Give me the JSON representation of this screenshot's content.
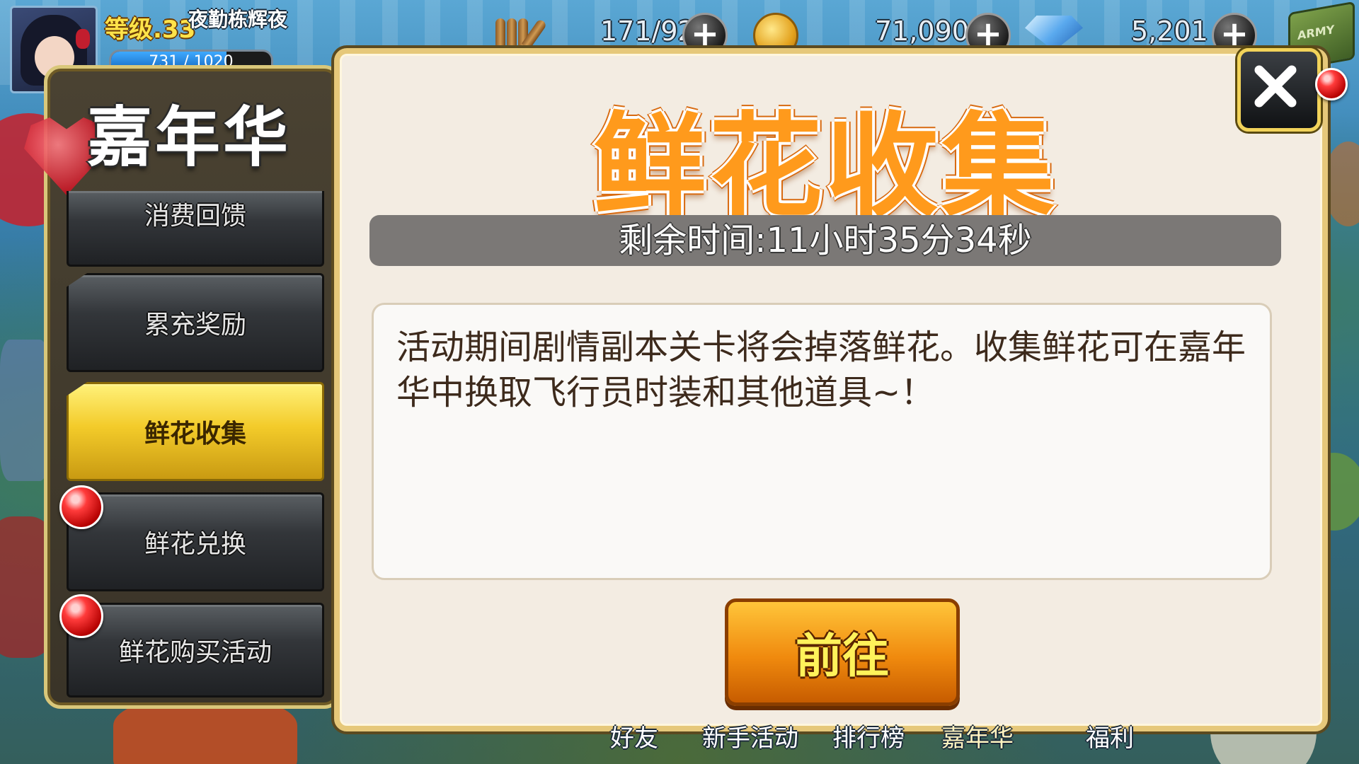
{
  "player": {
    "level_label": "等级.33",
    "name": "夜勤栋辉夜",
    "exp_text": "731 / 1020",
    "exp_progress": 0.72
  },
  "resources": {
    "stamina": "171/92",
    "gold": "71,090",
    "diamond": "5,201"
  },
  "army_box_label": "ARMY",
  "sidebar": {
    "title": "嘉年华",
    "items": [
      {
        "label": "消费回馈",
        "active": false,
        "badge": false
      },
      {
        "label": "累充奖励",
        "active": false,
        "badge": false
      },
      {
        "label": "鲜花收集",
        "active": true,
        "badge": false
      },
      {
        "label": "鲜花兑换",
        "active": false,
        "badge": true
      },
      {
        "label": "鲜花购买活动",
        "active": false,
        "badge": true
      }
    ]
  },
  "popup": {
    "title": "鲜花收集",
    "timer_text": "剩余时间:11小时35分34秒",
    "description": "活动期间剧情副本关卡将会掉落鲜花。收集鲜花可在嘉年华中换取飞行员时装和其他道具~！",
    "go_button": "前往"
  },
  "bottom_nav": [
    "好友",
    "新手活动",
    "排行榜",
    "嘉年华",
    "福利"
  ],
  "colors": {
    "title_orange": "#ff9a1c",
    "active_tab": "#f3cb2a",
    "popup_bg": "#f3ece2",
    "timer_bg": "#7b7876",
    "go_button": "#f08a0e"
  }
}
